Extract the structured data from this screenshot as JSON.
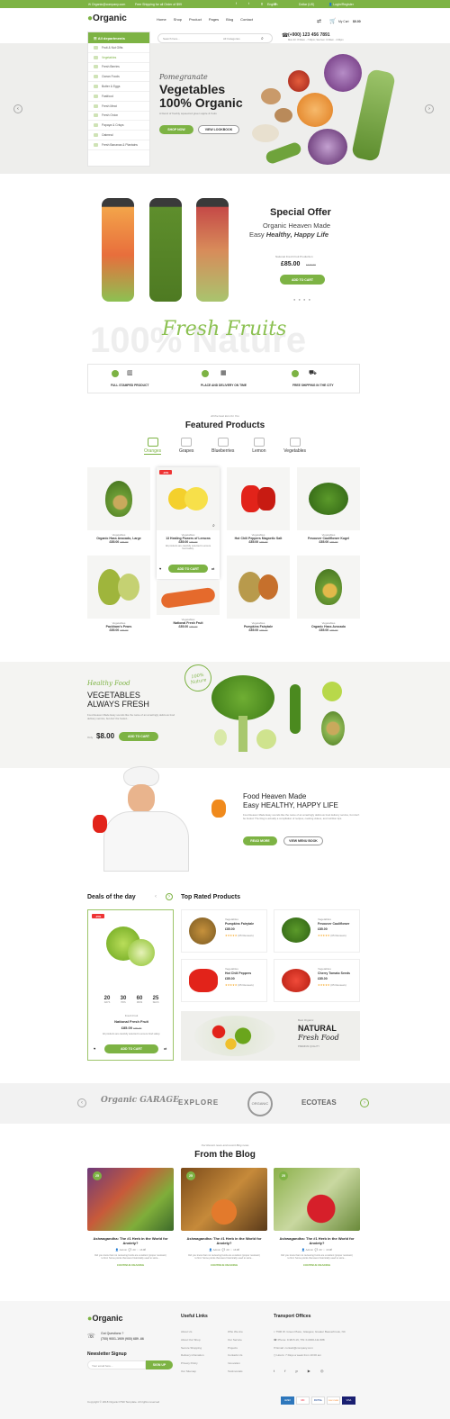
{
  "topbar": {
    "email": "Organic@company.com",
    "shipping": "Free Shipping for all Order of $99",
    "language": "English",
    "currency": "Dollar (US)",
    "login": "Login/Register"
  },
  "header": {
    "logo": "Organic",
    "nav": [
      "Home",
      "Shop",
      "Product",
      "Pages",
      "Blog",
      "Contact"
    ],
    "search_placeholder": "Search here...",
    "category": "All Categories",
    "phone": "(+900) 123 456 7891",
    "hours": "Mon-Fri: 8:30am - 7:30pm; Sat-Sun: 9:30am - 4:30pm",
    "cart_label": "My Cart",
    "cart_total": "$0.00"
  },
  "categories": {
    "title": "All departments",
    "items": [
      "Fruit & Nut Gifts",
      "Vegetables",
      "Fresh Berries",
      "Ocean Foods",
      "Butter & Eggs",
      "Fastfood",
      "Fresh Meat",
      "Fresh Onion",
      "Papaya & Crisps",
      "Oatmeal",
      "Fresh Bananas & Plantains"
    ]
  },
  "hero": {
    "script": "Pomegranate",
    "title1": "Vegetables",
    "title2": "100% Organic",
    "sub": "A blend of freshly squeezed green apple & fruits",
    "btn1": "SHOP NOW",
    "btn2": "VIEW LOOKBOOK"
  },
  "offer": {
    "title": "Special Offer",
    "line1": "Organic Heaven Made",
    "line2a": "Easy ",
    "line2b": "Healthy, Happy Life",
    "product": "National Fresh Fruit Production",
    "price": "£85.00",
    "old": "£120.00",
    "btn": "ADD TO CART"
  },
  "fresh": {
    "bg": "100% Nature",
    "title": "Fresh Fruits",
    "features": [
      "FULL STAMPED PRODUCT",
      "PLACE AND DELIVERY ON TIME",
      "FREE SHIPPING IN THE CITY"
    ]
  },
  "featured": {
    "sub": "All the best item for You",
    "title": "Featured Products",
    "tabs": [
      "Oranges",
      "Grapes",
      "Blueberries",
      "Lemon",
      "Vegetables"
    ],
    "products": [
      {
        "cat": "Vegetables",
        "name": "Organic Hass Avocado, Large",
        "price": "£85.00",
        "old": "£99.00"
      },
      {
        "cat": "Vegetables",
        "name": "13 Healing Powers of Lemons",
        "price": "£85.00",
        "old": "£99.00",
        "badge": "-10%",
        "desc": "All products are carefully selected to ensure food safety.",
        "btn": "ADD TO CART"
      },
      {
        "cat": "Vegetables",
        "name": "Hot Chili Peppers Magnetic Salt",
        "price": "£85.00",
        "old": "£99.00"
      },
      {
        "cat": "Vegetables",
        "name": "Fesouver Cauliflower Kugel",
        "price": "£85.00",
        "old": "£99.00"
      },
      {
        "cat": "Vegetables",
        "name": "Packham's Pears",
        "price": "£85.00",
        "old": "£99.00"
      },
      {
        "cat": "Vegetables",
        "name": "National Fresh Fruit",
        "price": "£85.00",
        "old": "£99.00"
      },
      {
        "cat": "Vegetables",
        "name": "Pumpkins Fairytale",
        "price": "£85.00",
        "old": "£99.00"
      },
      {
        "cat": "Vegetables",
        "name": "Organic Hass Avocado",
        "price": "£85.00",
        "old": "£99.00"
      }
    ]
  },
  "banner1": {
    "tag": "Healthy Food",
    "title1": "VEGETABLES",
    "title2": "ALWAYS FRESH",
    "desc": "Food Heaven Made Easy sounds like the name of an amazingly delicious food delivery service, but don't be fooled...",
    "from": "Only",
    "price": "$8.00",
    "btn": "ADD TO CART",
    "stamp": "100% Nature"
  },
  "banner2": {
    "title1": "Food Heaven Made",
    "title2": "Easy HEALTHY, HAPPY LIFE",
    "desc": "Food Heaven Made Easy sounds like the name of an amazingly delicious food delivery service, but don't be fooled. The blog is actually a compilation of recipes, cooking videos, and nutrition tips.",
    "btn1": "READ MORE",
    "btn2": "VIEW MENU BOOK"
  },
  "deals": {
    "title": "Deals of the day",
    "badge": "-15%",
    "timer": [
      {
        "v": "20",
        "l": "DAYS"
      },
      {
        "v": "30",
        "l": "HRS"
      },
      {
        "v": "60",
        "l": "MINS"
      },
      {
        "v": "25",
        "l": "SECS"
      }
    ],
    "cat": "Fresh Fruit",
    "name": "National Fresh Fruit",
    "price": "£85.00",
    "old": "£99.00",
    "desc": "All products are carefully selected to ensure food safety.",
    "btn": "ADD TO CART"
  },
  "toprated": {
    "title": "Top Rated Products",
    "items": [
      {
        "cat": "Vegetables",
        "name": "Pumpkins Fairytale",
        "price": "£85.00",
        "rev": "(05 Reviews)"
      },
      {
        "cat": "Vegetables",
        "name": "Fesouver Cauliflower",
        "price": "£85.00",
        "rev": "(05 Reviews)"
      },
      {
        "cat": "Vegetables",
        "name": "Hot Chili Peppers",
        "price": "£85.00",
        "rev": "(05 Reviews)"
      },
      {
        "cat": "Vegetables",
        "name": "Cherry Tomato Seeds",
        "price": "£85.00",
        "rev": "(05 Reviews)"
      }
    ]
  },
  "natural": {
    "sub": "Best Organic",
    "title1": "NATURAL",
    "title2": "Fresh Food",
    "tag": "PREMIUM QUALITY"
  },
  "brands": [
    "Organic GARAGE",
    "EXPLORE",
    "ORGANIC",
    "ECOTEAS"
  ],
  "blog": {
    "sub": "Our Recent news and recent Blog news",
    "title": "From the Blog",
    "posts": [
      {
        "day": "25",
        "title": "Ashwagandha: The #1 Herb in the World for Anxiety?",
        "author": "Admin",
        "comments": "20",
        "likes": "16",
        "desc": "Did you know that not reviewing foods are excellent (proper resistant) to find. Some points that were historically used to store...",
        "more": "CONTINUE READING"
      },
      {
        "day": "25",
        "title": "Ashwagandha: The #1 Herb in the World for Anxiety?",
        "author": "Admin",
        "comments": "20",
        "likes": "16",
        "desc": "Did you know that not reviewing foods are excellent (proper resistant) to find. Some points that were historically used to store...",
        "more": "CONTINUE READING"
      },
      {
        "day": "25",
        "title": "Ashwagandha: The #1 Herb in the World for Anxiety?",
        "author": "Admin",
        "comments": "20",
        "likes": "16",
        "desc": "Did you know that not reviewing foods are excellent (proper resistant) to find. Some points that were historically used to store...",
        "more": "CONTINUE READING"
      }
    ]
  },
  "footer": {
    "logo": "Organic",
    "question": "Got Questions ?",
    "phones": "(700) 9001-1909 (900) 689 -66",
    "newsletter": "Newsletter Signup",
    "email_placeholder": "Your email here...",
    "signup": "SIGN UP",
    "links_title": "Useful Links",
    "links1": [
      "About Us",
      "About Our Shop",
      "Secure Shopping",
      "Delivery infomation",
      "Privacy Policy",
      "Our Sitemap"
    ],
    "links2": [
      "Who We Are",
      "Our Service",
      "Projects",
      "Contacts Us",
      "Innovation",
      "Testimonials"
    ],
    "transport_title": "Transport Offices",
    "address": "7500 W. Green Place, Glasgow, Greater Beaverbrook, NC",
    "phone": "Phone: 0-98-5.19, TW: 0-0000-111-588",
    "email": "Email: contact@company.com",
    "hours": "Hours: 7 Days a week from 10:00 am",
    "copyright": "Copyright © 2018 Organic PSD Template. All rights reserved",
    "payments": [
      "AMEX",
      "MC",
      "PAYPAL",
      "DISCOVER",
      "VISA"
    ]
  },
  "colors": {
    "accent": "#7db344",
    "dark": "#222222"
  }
}
